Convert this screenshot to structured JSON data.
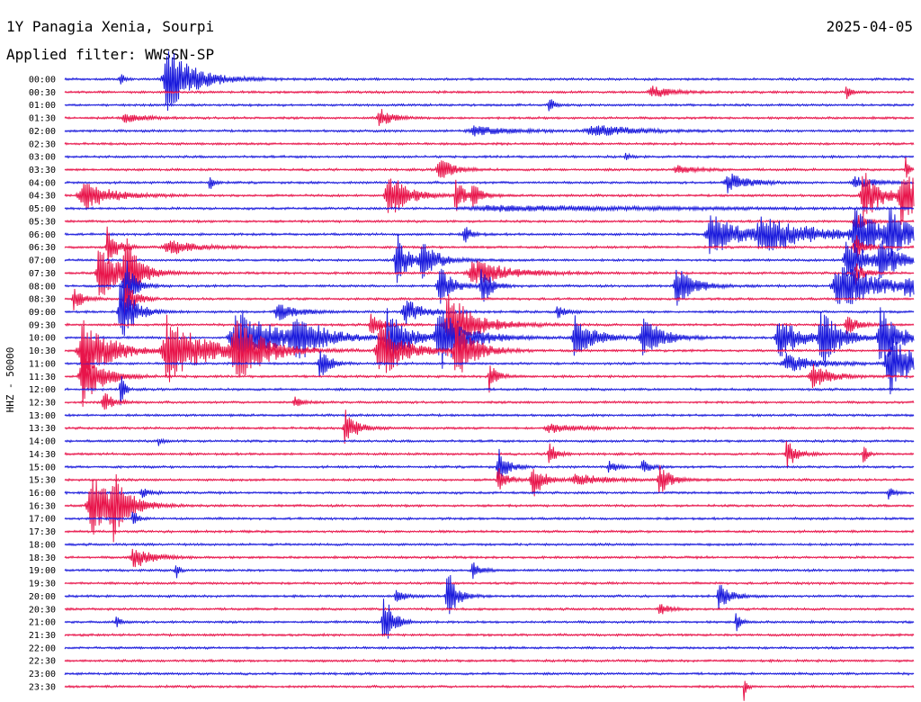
{
  "header": {
    "station": "1Y Panagia Xenia, Sourpi",
    "date": "2025-04-05",
    "filter": "Applied filter: WWSSN-SP"
  },
  "axis": {
    "ylabel": "HHZ - 50000"
  },
  "colors": {
    "even_row": "#1a1adc",
    "odd_row": "#e8144a",
    "background": "#ffffff"
  },
  "chart_data": {
    "type": "helicorder",
    "rows": [
      {
        "time": "00:00",
        "color": "blue",
        "events": [
          {
            "t": 0.12,
            "a": 1.0,
            "w": 0.03
          },
          {
            "t": 0.065,
            "a": 0.25,
            "w": 0.004
          }
        ]
      },
      {
        "time": "00:30",
        "color": "red",
        "events": [
          {
            "t": 0.69,
            "a": 0.2,
            "w": 0.02
          },
          {
            "t": 0.92,
            "a": 0.25,
            "w": 0.005
          }
        ]
      },
      {
        "time": "01:00",
        "color": "blue",
        "events": [
          {
            "t": 0.57,
            "a": 0.4,
            "w": 0.004
          }
        ]
      },
      {
        "time": "01:30",
        "color": "red",
        "events": [
          {
            "t": 0.37,
            "a": 0.35,
            "w": 0.012
          },
          {
            "t": 0.07,
            "a": 0.15,
            "w": 0.02
          }
        ]
      },
      {
        "time": "02:00",
        "color": "blue",
        "events": [
          {
            "t": 0.48,
            "a": 0.15,
            "w": 0.04
          },
          {
            "t": 0.62,
            "a": 0.2,
            "w": 0.04
          }
        ]
      },
      {
        "time": "02:30",
        "color": "red",
        "events": []
      },
      {
        "time": "03:00",
        "color": "blue",
        "events": [
          {
            "t": 0.66,
            "a": 0.1,
            "w": 0.005
          }
        ]
      },
      {
        "time": "03:30",
        "color": "red",
        "events": [
          {
            "t": 0.44,
            "a": 0.4,
            "w": 0.015
          },
          {
            "t": 0.72,
            "a": 0.15,
            "w": 0.02
          },
          {
            "t": 0.99,
            "a": 0.5,
            "w": 0.003
          }
        ]
      },
      {
        "time": "04:00",
        "color": "blue",
        "events": [
          {
            "t": 0.17,
            "a": 0.35,
            "w": 0.004
          },
          {
            "t": 0.78,
            "a": 0.35,
            "w": 0.02
          },
          {
            "t": 0.93,
            "a": 0.2,
            "w": 0.02
          }
        ]
      },
      {
        "time": "04:30",
        "color": "red",
        "events": [
          {
            "t": 0.02,
            "a": 0.5,
            "w": 0.03
          },
          {
            "t": 0.38,
            "a": 0.8,
            "w": 0.02
          },
          {
            "t": 0.46,
            "a": 0.55,
            "w": 0.01
          },
          {
            "t": 0.48,
            "a": 0.45,
            "w": 0.008
          },
          {
            "t": 0.94,
            "a": 0.8,
            "w": 0.02
          },
          {
            "t": 0.985,
            "a": 0.8,
            "w": 0.025
          }
        ]
      },
      {
        "time": "05:00",
        "color": "blue",
        "events": [
          {
            "t": 0.5,
            "a": 0.08,
            "w": 0.2
          }
        ]
      },
      {
        "time": "05:30",
        "color": "red",
        "events": [
          {
            "t": 0.93,
            "a": 0.35,
            "w": 0.01
          }
        ]
      },
      {
        "time": "06:00",
        "color": "blue",
        "events": [
          {
            "t": 0.76,
            "a": 0.7,
            "w": 0.03
          },
          {
            "t": 0.82,
            "a": 0.5,
            "w": 0.06
          },
          {
            "t": 0.93,
            "a": 0.7,
            "w": 0.03
          },
          {
            "t": 0.97,
            "a": 0.6,
            "w": 0.02
          },
          {
            "t": 0.47,
            "a": 0.3,
            "w": 0.008
          }
        ]
      },
      {
        "time": "06:30",
        "color": "red",
        "events": [
          {
            "t": 0.05,
            "a": 0.7,
            "w": 0.01
          },
          {
            "t": 0.12,
            "a": 0.25,
            "w": 0.03
          },
          {
            "t": 0.93,
            "a": 0.5,
            "w": 0.01
          }
        ]
      },
      {
        "time": "07:00",
        "color": "blue",
        "events": [
          {
            "t": 0.39,
            "a": 0.9,
            "w": 0.012
          },
          {
            "t": 0.42,
            "a": 0.5,
            "w": 0.02
          },
          {
            "t": 0.92,
            "a": 0.8,
            "w": 0.02
          },
          {
            "t": 0.96,
            "a": 0.6,
            "w": 0.02
          }
        ]
      },
      {
        "time": "07:30",
        "color": "red",
        "events": [
          {
            "t": 0.04,
            "a": 1.0,
            "w": 0.02
          },
          {
            "t": 0.07,
            "a": 1.0,
            "w": 0.015
          },
          {
            "t": 0.48,
            "a": 0.4,
            "w": 0.04
          },
          {
            "t": 0.93,
            "a": 0.4,
            "w": 0.01
          }
        ]
      },
      {
        "time": "08:00",
        "color": "blue",
        "events": [
          {
            "t": 0.44,
            "a": 0.7,
            "w": 0.015
          },
          {
            "t": 0.49,
            "a": 0.7,
            "w": 0.01
          },
          {
            "t": 0.72,
            "a": 0.6,
            "w": 0.02
          },
          {
            "t": 0.91,
            "a": 0.8,
            "w": 0.04
          },
          {
            "t": 0.99,
            "a": 0.4,
            "w": 0.01
          },
          {
            "t": 0.07,
            "a": 1.0,
            "w": 0.01
          }
        ]
      },
      {
        "time": "08:30",
        "color": "red",
        "events": [
          {
            "t": 0.01,
            "a": 0.4,
            "w": 0.01
          },
          {
            "t": 0.07,
            "a": 0.8,
            "w": 0.01
          }
        ]
      },
      {
        "time": "09:00",
        "color": "blue",
        "events": [
          {
            "t": 0.065,
            "a": 1.0,
            "w": 0.015
          },
          {
            "t": 0.25,
            "a": 0.3,
            "w": 0.02
          },
          {
            "t": 0.4,
            "a": 0.4,
            "w": 0.02
          },
          {
            "t": 0.58,
            "a": 0.2,
            "w": 0.01
          }
        ]
      },
      {
        "time": "09:30",
        "color": "red",
        "events": [
          {
            "t": 0.45,
            "a": 1.0,
            "w": 0.03
          },
          {
            "t": 0.36,
            "a": 0.4,
            "w": 0.01
          },
          {
            "t": 0.92,
            "a": 0.4,
            "w": 0.01
          }
        ]
      },
      {
        "time": "10:00",
        "color": "blue",
        "events": [
          {
            "t": 0.2,
            "a": 1.0,
            "w": 0.04
          },
          {
            "t": 0.27,
            "a": 0.7,
            "w": 0.03
          },
          {
            "t": 0.38,
            "a": 1.0,
            "w": 0.02
          },
          {
            "t": 0.44,
            "a": 1.0,
            "w": 0.03
          },
          {
            "t": 0.6,
            "a": 0.7,
            "w": 0.02
          },
          {
            "t": 0.68,
            "a": 0.7,
            "w": 0.02
          },
          {
            "t": 0.84,
            "a": 0.8,
            "w": 0.02
          },
          {
            "t": 0.89,
            "a": 0.9,
            "w": 0.02
          },
          {
            "t": 0.96,
            "a": 0.9,
            "w": 0.02
          }
        ]
      },
      {
        "time": "10:30",
        "color": "red",
        "events": [
          {
            "t": 0.02,
            "a": 1.0,
            "w": 0.03
          },
          {
            "t": 0.12,
            "a": 1.0,
            "w": 0.04
          },
          {
            "t": 0.2,
            "a": 1.0,
            "w": 0.03
          },
          {
            "t": 0.37,
            "a": 1.0,
            "w": 0.025
          },
          {
            "t": 0.46,
            "a": 1.0,
            "w": 0.02
          }
        ]
      },
      {
        "time": "11:00",
        "color": "blue",
        "events": [
          {
            "t": 0.97,
            "a": 1.0,
            "w": 0.025
          },
          {
            "t": 0.3,
            "a": 0.6,
            "w": 0.01
          },
          {
            "t": 0.85,
            "a": 0.3,
            "w": 0.03
          }
        ]
      },
      {
        "time": "11:30",
        "color": "red",
        "events": [
          {
            "t": 0.02,
            "a": 1.0,
            "w": 0.02
          },
          {
            "t": 0.5,
            "a": 0.5,
            "w": 0.008
          },
          {
            "t": 0.88,
            "a": 0.4,
            "w": 0.02
          }
        ]
      },
      {
        "time": "12:00",
        "color": "blue",
        "events": [
          {
            "t": 0.065,
            "a": 0.7,
            "w": 0.004
          }
        ]
      },
      {
        "time": "12:30",
        "color": "red",
        "events": [
          {
            "t": 0.045,
            "a": 0.4,
            "w": 0.01
          },
          {
            "t": 0.27,
            "a": 0.15,
            "w": 0.01
          }
        ]
      },
      {
        "time": "13:00",
        "color": "blue",
        "events": []
      },
      {
        "time": "13:30",
        "color": "red",
        "events": [
          {
            "t": 0.33,
            "a": 0.6,
            "w": 0.012
          },
          {
            "t": 0.57,
            "a": 0.15,
            "w": 0.03
          }
        ]
      },
      {
        "time": "14:00",
        "color": "blue",
        "events": [
          {
            "t": 0.11,
            "a": 0.15,
            "w": 0.005
          }
        ]
      },
      {
        "time": "14:30",
        "color": "red",
        "events": [
          {
            "t": 0.57,
            "a": 0.6,
            "w": 0.006
          },
          {
            "t": 0.85,
            "a": 0.5,
            "w": 0.01
          },
          {
            "t": 0.94,
            "a": 0.4,
            "w": 0.004
          }
        ]
      },
      {
        "time": "15:00",
        "color": "blue",
        "events": [
          {
            "t": 0.51,
            "a": 0.6,
            "w": 0.01
          },
          {
            "t": 0.64,
            "a": 0.2,
            "w": 0.01
          },
          {
            "t": 0.68,
            "a": 0.2,
            "w": 0.01
          }
        ]
      },
      {
        "time": "15:30",
        "color": "red",
        "events": [
          {
            "t": 0.51,
            "a": 0.4,
            "w": 0.01
          },
          {
            "t": 0.55,
            "a": 0.6,
            "w": 0.012
          },
          {
            "t": 0.7,
            "a": 0.5,
            "w": 0.012
          },
          {
            "t": 0.6,
            "a": 0.2,
            "w": 0.03
          }
        ]
      },
      {
        "time": "16:00",
        "color": "blue",
        "events": [
          {
            "t": 0.97,
            "a": 0.3,
            "w": 0.005
          },
          {
            "t": 0.09,
            "a": 0.15,
            "w": 0.01
          }
        ]
      },
      {
        "time": "16:30",
        "color": "red",
        "events": [
          {
            "t": 0.03,
            "a": 1.0,
            "w": 0.025
          },
          {
            "t": 0.055,
            "a": 0.9,
            "w": 0.015
          }
        ]
      },
      {
        "time": "17:00",
        "color": "blue",
        "events": [
          {
            "t": 0.08,
            "a": 0.3,
            "w": 0.005
          }
        ]
      },
      {
        "time": "17:30",
        "color": "red",
        "events": []
      },
      {
        "time": "18:00",
        "color": "blue",
        "events": []
      },
      {
        "time": "18:30",
        "color": "red",
        "events": [
          {
            "t": 0.08,
            "a": 0.35,
            "w": 0.02
          }
        ]
      },
      {
        "time": "19:00",
        "color": "blue",
        "events": [
          {
            "t": 0.13,
            "a": 0.4,
            "w": 0.003
          },
          {
            "t": 0.48,
            "a": 0.3,
            "w": 0.008
          }
        ]
      },
      {
        "time": "19:30",
        "color": "red",
        "events": []
      },
      {
        "time": "20:00",
        "color": "blue",
        "events": [
          {
            "t": 0.45,
            "a": 0.9,
            "w": 0.01
          },
          {
            "t": 0.39,
            "a": 0.25,
            "w": 0.01
          },
          {
            "t": 0.77,
            "a": 0.4,
            "w": 0.012
          }
        ]
      },
      {
        "time": "20:30",
        "color": "red",
        "events": [
          {
            "t": 0.7,
            "a": 0.2,
            "w": 0.01
          }
        ]
      },
      {
        "time": "21:00",
        "color": "blue",
        "events": [
          {
            "t": 0.375,
            "a": 1.0,
            "w": 0.01
          },
          {
            "t": 0.79,
            "a": 0.35,
            "w": 0.005
          },
          {
            "t": 0.06,
            "a": 0.2,
            "w": 0.005
          }
        ]
      },
      {
        "time": "21:30",
        "color": "red",
        "events": []
      },
      {
        "time": "22:00",
        "color": "blue",
        "events": []
      },
      {
        "time": "22:30",
        "color": "red",
        "events": []
      },
      {
        "time": "23:00",
        "color": "blue",
        "events": []
      },
      {
        "time": "23:30",
        "color": "red",
        "events": [
          {
            "t": 0.8,
            "a": 0.4,
            "w": 0.003
          }
        ]
      }
    ]
  }
}
